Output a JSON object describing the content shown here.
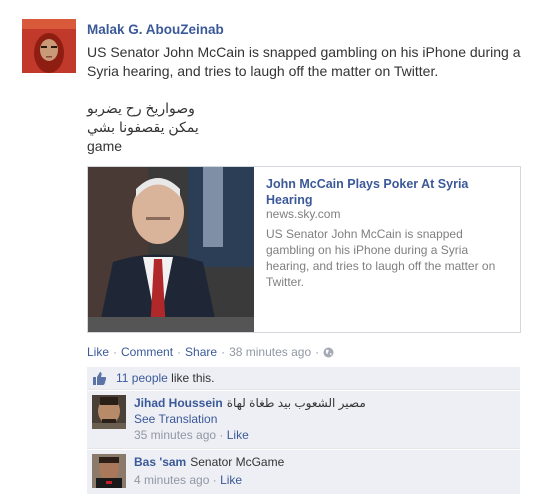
{
  "post": {
    "author": "Malak G. AbouZeinab",
    "message": "US Senator John McCain is snapped gambling on his iPhone during a Syria hearing, and tries to laugh off the matter on Twitter.",
    "extra_lines": [
      "وصواريخ رح يضربو",
      "يمكن يقصفونا بشي",
      "game"
    ]
  },
  "share": {
    "title": "John McCain Plays Poker At Syria Hearing",
    "domain": "news.sky.com",
    "description": "US Senator John McCain is snapped gambling on his iPhone during a Syria hearing, and tries to laugh off the matter on Twitter."
  },
  "actions": {
    "like": "Like",
    "comment": "Comment",
    "share": "Share",
    "timestamp": "38 minutes ago",
    "separator": "·",
    "audience_icon": "globe-icon"
  },
  "likes": {
    "count_link": "11 people",
    "suffix": "like this."
  },
  "comments": [
    {
      "name": "Jihad Houssein",
      "text": "مصير الشعوب بيد طغاة لهاة",
      "see_translation": "See Translation",
      "time": "35 minutes ago",
      "like": "Like"
    },
    {
      "name": "Bas 'sam",
      "text": "Senator McGame",
      "time": "4 minutes ago",
      "like": "Like"
    }
  ],
  "colors": {
    "link": "#3b5998",
    "meta": "#9197a3",
    "ufi_bg": "#edeff4"
  }
}
